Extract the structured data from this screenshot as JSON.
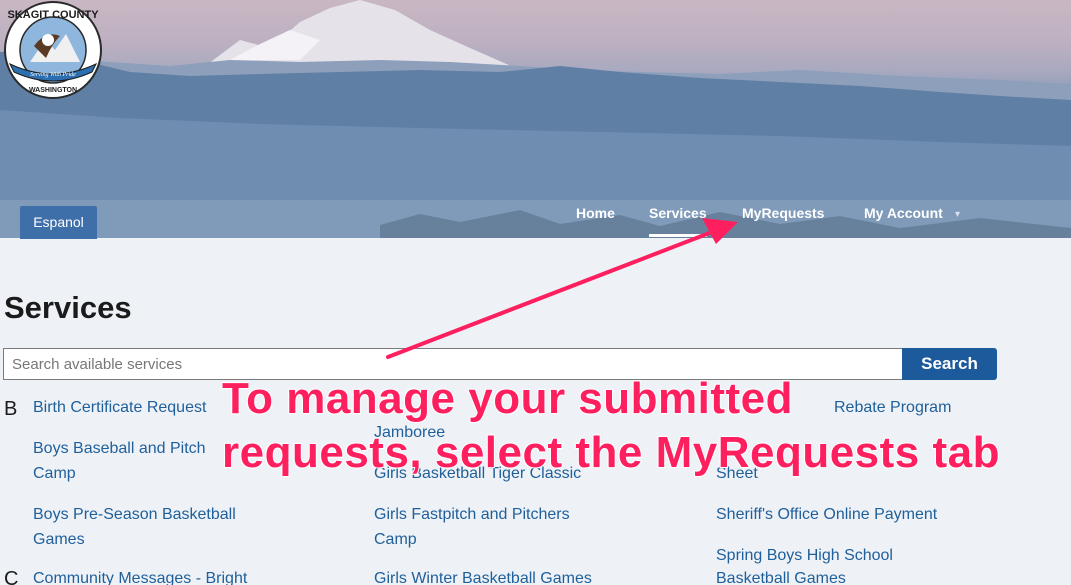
{
  "header": {
    "espanol_label": "Espanol",
    "logo_text_top": "SKAGIT COUNTY",
    "logo_text_ribbon": "Serving With Pride",
    "logo_text_bottom": "WASHINGTON"
  },
  "nav": {
    "items": [
      {
        "label": "Home"
      },
      {
        "label": "Services"
      },
      {
        "label": "MyRequests"
      },
      {
        "label": "My Account"
      }
    ],
    "active": "Services",
    "account_caret_icon": "chevron-down-icon"
  },
  "main": {
    "title": "Services",
    "search": {
      "placeholder": "Search available services",
      "value": "",
      "button_label": "Search"
    },
    "letters": [
      "B",
      "C"
    ],
    "services": {
      "col1": [
        "Birth Certificate Request",
        "Boys Baseball and Pitch",
        "Camp",
        "Boys Pre-Season Basketball",
        "Games",
        "Community Messages - Bright"
      ],
      "col2": [
        "Jamboree",
        "Girls Basketball Tiger Classic",
        "Girls Fastpitch and Pitchers",
        "Camp",
        "Girls Winter Basketball Games"
      ],
      "col3": [
        "Rebate Program",
        "Sheet",
        "Sheriff's Office Online Payment",
        "Spring Boys High School",
        "Basketball Games"
      ]
    }
  },
  "annotation": {
    "line1": "To manage your submitted",
    "line2": "requests, select the MyRequests tab",
    "color": "#fe1f5f"
  }
}
